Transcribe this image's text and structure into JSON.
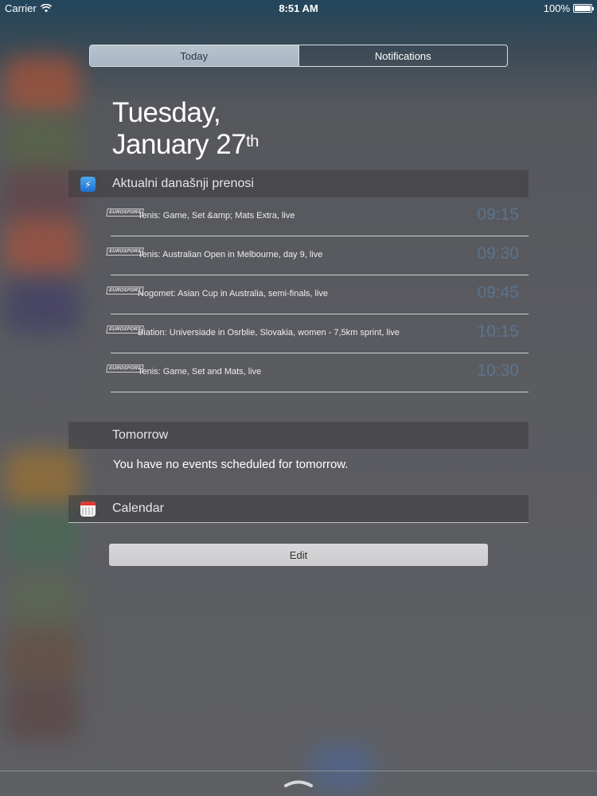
{
  "status_bar": {
    "carrier": "Carrier",
    "time": "8:51 AM",
    "battery": "100%"
  },
  "tabs": [
    {
      "label": "Today",
      "active": true
    },
    {
      "label": "Notifications",
      "active": false
    }
  ],
  "date": {
    "line1": "Tuesday,",
    "line2": "January 27",
    "suffix": "th"
  },
  "widgets": {
    "eurosport": {
      "title": "Aktualni današnji prenosi",
      "logo_text": "EUROSPORT",
      "events": [
        {
          "title": "Tenis: Game, Set &amp; Mats Extra, live",
          "time": "09:15"
        },
        {
          "title": "Tenis: Australian Open in Melbourne, day 9, live",
          "time": "09:30"
        },
        {
          "title": "Nogomet: Asian Cup in Australia, semi-finals, live",
          "time": "09:45"
        },
        {
          "title": "Biation: Universiade in Osrblie, Slovakia, women - 7,5km sprint, live",
          "time": "10:15"
        },
        {
          "title": "Tenis: Game, Set and Mats, live",
          "time": "10:30"
        }
      ]
    },
    "tomorrow": {
      "title": "Tomorrow",
      "message": "You have no events scheduled for tomorrow."
    },
    "calendar": {
      "title": "Calendar"
    }
  },
  "edit_button": "Edit",
  "colors": {
    "event_time": "#5b7ea3",
    "active_tab": "#b7c3cf"
  }
}
